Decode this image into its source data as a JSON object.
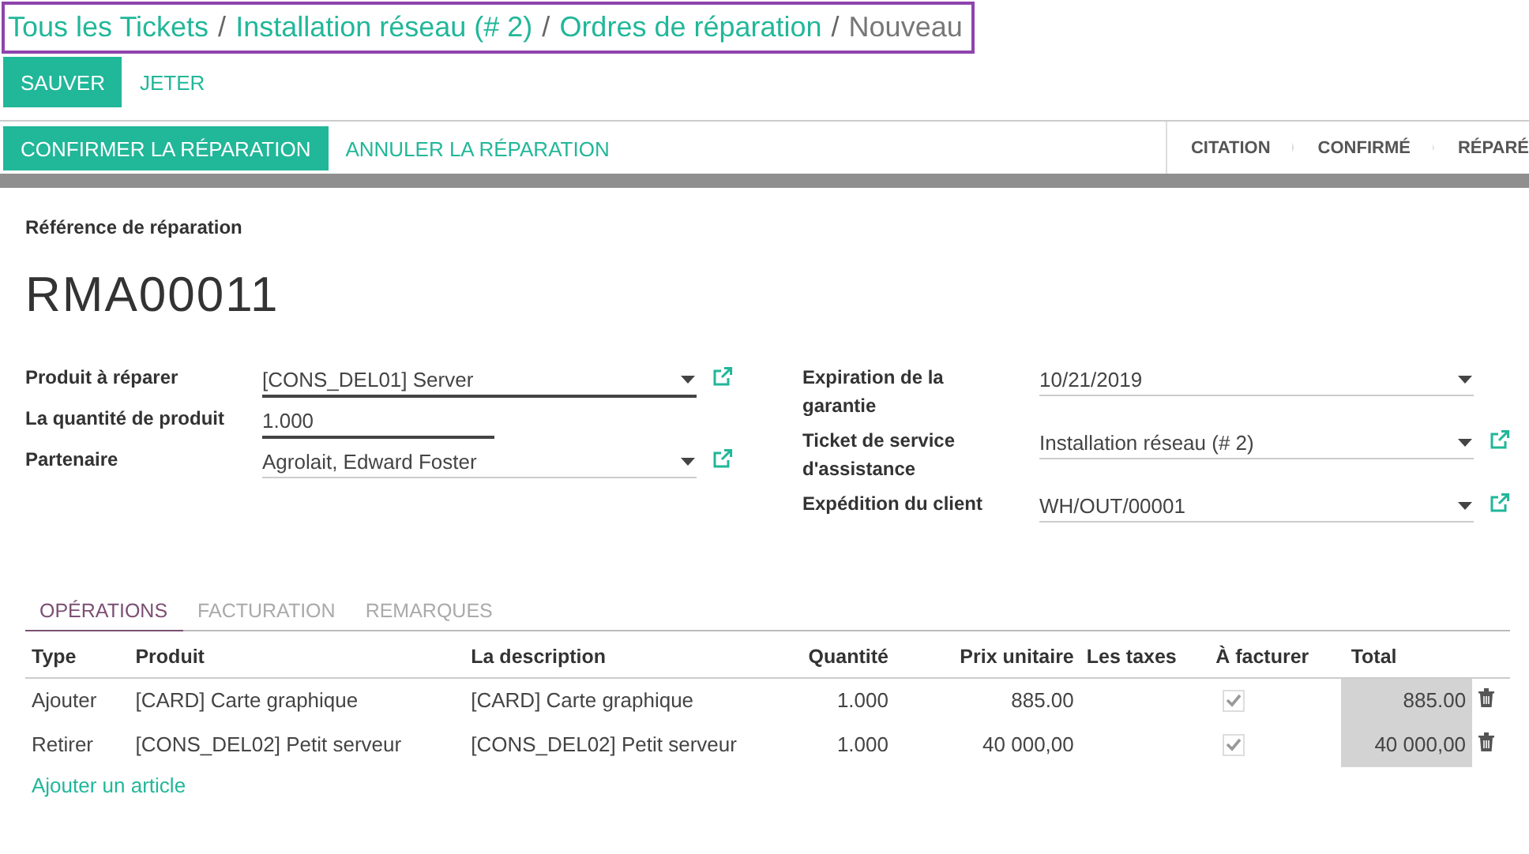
{
  "breadcrumbs": [
    {
      "label": "Tous les Tickets",
      "current": false
    },
    {
      "label": "Installation réseau (# 2)",
      "current": false
    },
    {
      "label": "Ordres de réparation",
      "current": false
    },
    {
      "label": "Nouveau",
      "current": true
    }
  ],
  "breadcrumb_separator": "/",
  "buttons": [
    {
      "label": "SAUVER",
      "primary": true
    },
    {
      "label": "JETER",
      "primary": false
    }
  ],
  "actions": [
    {
      "label": "CONFIRMER LA RÉPARATION",
      "primary": true
    },
    {
      "label": "ANNULER LA RÉPARATION",
      "primary": false
    }
  ],
  "stages": [
    "CITATION",
    "CONFIRMÉ",
    "RÉPARÉ"
  ],
  "form": {
    "reference_label": "Référence de réparation",
    "reference": "RMA00011",
    "left_fields": [
      {
        "label": "Produit à réparer",
        "value": "[CONS_DEL01] Server",
        "kind": "select",
        "link": true,
        "focused": true
      },
      {
        "label": "La quantité de produit",
        "value": "1.000",
        "kind": "input",
        "link": false,
        "focused": true
      },
      {
        "label": "Partenaire",
        "value": "Agrolait, Edward Foster",
        "kind": "select",
        "link": true,
        "focused": false
      }
    ],
    "right_fields": [
      {
        "label": "Expiration de la garantie",
        "value": "10/21/2019",
        "kind": "select",
        "link": false,
        "focused": false
      },
      {
        "label": "Ticket de service d'assistance",
        "value": "Installation réseau  (# 2)",
        "kind": "select",
        "link": true,
        "focused": false
      },
      {
        "label": "Expédition du client",
        "value": "WH/OUT/00001",
        "kind": "select",
        "link": true,
        "focused": false
      }
    ]
  },
  "tabs": [
    {
      "label": "OPÉRATIONS",
      "selected": true
    },
    {
      "label": "FACTURATION",
      "selected": false
    },
    {
      "label": "REMARQUES",
      "selected": false
    }
  ],
  "table": {
    "columns": [
      "Type",
      "Produit",
      "La description",
      "Quantité",
      "Prix unitaire",
      "Les taxes",
      "À facturer",
      "Total"
    ],
    "rows": [
      {
        "type": "Ajouter",
        "product": "[CARD] Carte graphique",
        "description": "[CARD] Carte graphique",
        "quantity": "1.000",
        "unit_price": "885.00",
        "to_invoice": true,
        "total": "885.00"
      },
      {
        "type": "Retirer",
        "product": "[CONS_DEL02] Petit serveur",
        "description": "[CONS_DEL02] Petit serveur",
        "quantity": "1.000",
        "unit_price": "40 000,00",
        "to_invoice": true,
        "total": "40 000,00"
      }
    ],
    "add_line": "Ajouter un article"
  }
}
